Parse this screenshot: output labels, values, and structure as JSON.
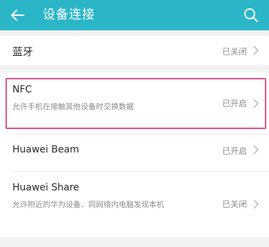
{
  "header": {
    "title": "设备连接",
    "back_icon": "back-arrow-icon",
    "search_icon": "search-icon",
    "bg_color": "#2bb6c8"
  },
  "items": [
    {
      "title": "蓝牙",
      "status": "已关闭"
    },
    {
      "title": "NFC",
      "subtitle": "允许手机在接触其他设备时交换数据",
      "status": "已开启",
      "highlight_color": "#d94a8a"
    },
    {
      "title": "Huawei Beam",
      "status": "已开启"
    },
    {
      "title": "Huawei Share",
      "subtitle": "允许附近的华为设备、同网络内电脑发现本机",
      "status": "已关闭"
    }
  ]
}
